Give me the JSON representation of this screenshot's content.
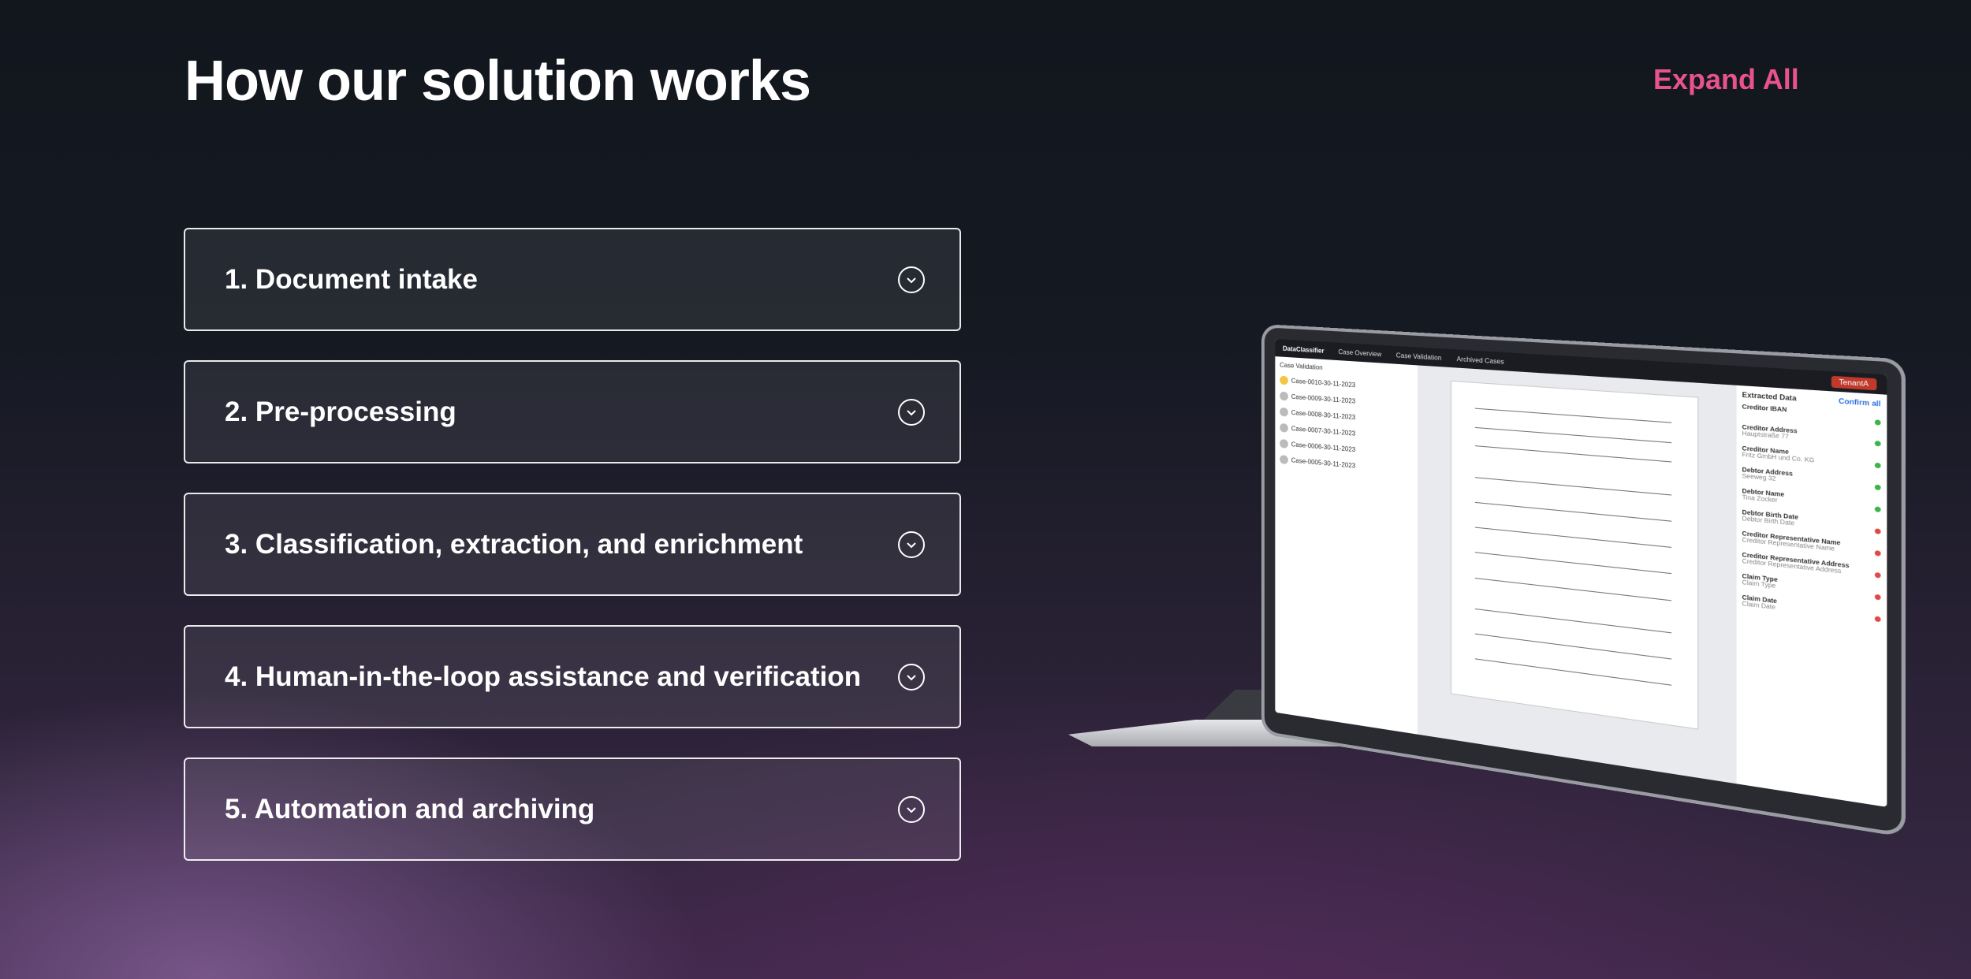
{
  "header": {
    "title": "How our solution works",
    "expand_label": "Expand All"
  },
  "steps": [
    {
      "label": "1.  Document intake"
    },
    {
      "label": "2.  Pre-processing"
    },
    {
      "label": "3.  Classification, extraction, and enrichment"
    },
    {
      "label": "4.  Human-in-the-loop assistance and verification"
    },
    {
      "label": "5.  Automation and archiving"
    }
  ],
  "colors": {
    "accent": "#e8538f",
    "background": "#12161d"
  },
  "icons": {
    "step_toggle": "chevron-down-circle-icon"
  },
  "laptop_screen": {
    "brand": "DataClassifier",
    "nav": [
      "Case Overview",
      "Case Validation",
      "Archived Cases"
    ],
    "tenant": "TenantA",
    "section": "Case Validation",
    "cases": [
      "Case-0010-30-11-2023",
      "Case-0009-30-11-2023",
      "Case-0008-30-11-2023",
      "Case-0007-30-11-2023",
      "Case-0006-30-11-2023",
      "Case-0005-30-11-2023"
    ],
    "panel_title": "Extracted Data",
    "confirm_label": "Confirm all",
    "fields": [
      {
        "name": "Creditor IBAN",
        "state": "ok"
      },
      {
        "name": "Creditor Address",
        "value": "Hauptstraße 77",
        "state": "ok"
      },
      {
        "name": "Creditor Name",
        "value": "Fritz GmbH und Co. KG",
        "state": "ok"
      },
      {
        "name": "Debtor Address",
        "value": "Seeweg 32",
        "state": "ok"
      },
      {
        "name": "Debtor Name",
        "value": "Tina Zocker",
        "state": "ok"
      },
      {
        "name": "Debtor Birth Date",
        "value": "Debtor Birth Date",
        "state": "missing"
      },
      {
        "name": "Creditor Representative Name",
        "value": "Creditor Representative Name",
        "state": "missing"
      },
      {
        "name": "Creditor Representative Address",
        "value": "Creditor Representative Address",
        "state": "missing"
      },
      {
        "name": "Claim Type",
        "value": "Claim Type",
        "state": "missing"
      },
      {
        "name": "Claim Date",
        "value": "Claim Date",
        "state": "missing"
      }
    ]
  }
}
